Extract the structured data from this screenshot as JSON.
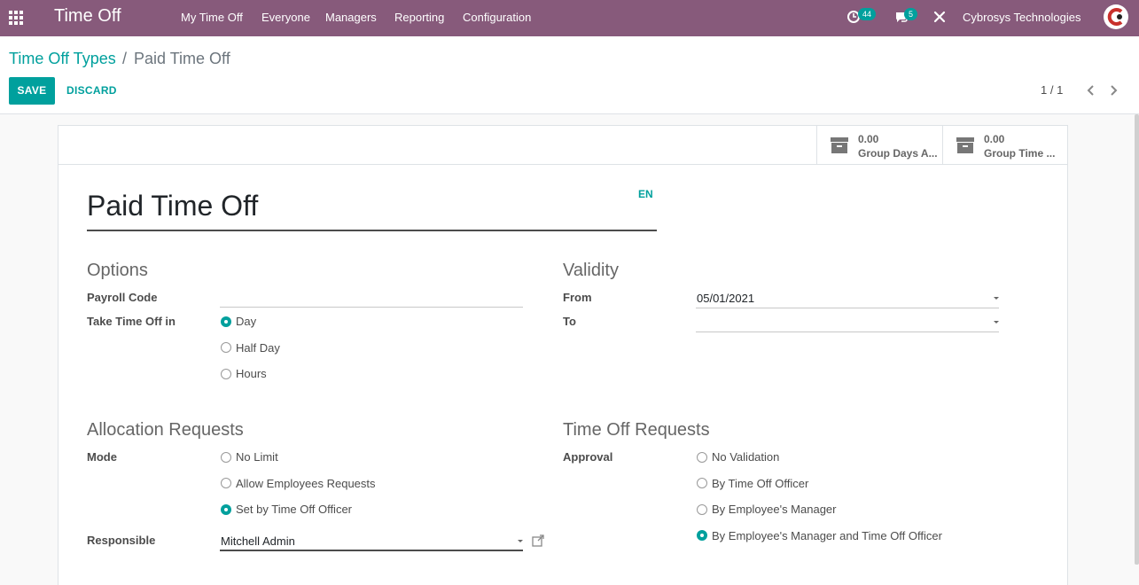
{
  "navbar": {
    "brand": "Time Off",
    "menu": [
      "My Time Off",
      "Everyone",
      "Managers",
      "Reporting",
      "Configuration"
    ],
    "activity_count": "44",
    "messages_count": "5",
    "company": "Cybrosys Technologies"
  },
  "breadcrumb": {
    "parent": "Time Off Types",
    "separator": "/",
    "current": "Paid Time Off"
  },
  "actions": {
    "save": "SAVE",
    "discard": "DISCARD"
  },
  "pager": {
    "value": "1 / 1"
  },
  "stat_buttons": [
    {
      "value": "0.00",
      "label": "Group Days A..."
    },
    {
      "value": "0.00",
      "label": "Group Time ..."
    }
  ],
  "form": {
    "name": "Paid Time Off",
    "lang": "EN",
    "options": {
      "title": "Options",
      "payroll_code_label": "Payroll Code",
      "payroll_code_value": "",
      "take_time_off_label": "Take Time Off in",
      "take_time_off_choices": [
        "Day",
        "Half Day",
        "Hours"
      ],
      "take_time_off_selected": "Day"
    },
    "validity": {
      "title": "Validity",
      "from_label": "From",
      "from_value": "05/01/2021",
      "to_label": "To",
      "to_value": ""
    },
    "allocation": {
      "title": "Allocation Requests",
      "mode_label": "Mode",
      "mode_choices": [
        "No Limit",
        "Allow Employees Requests",
        "Set by Time Off Officer"
      ],
      "mode_selected": "Set by Time Off Officer",
      "responsible_label": "Responsible",
      "responsible_value": "Mitchell Admin"
    },
    "time_off_requests": {
      "title": "Time Off Requests",
      "approval_label": "Approval",
      "approval_choices": [
        "No Validation",
        "By Time Off Officer",
        "By Employee's Manager",
        "By Employee's Manager and Time Off Officer"
      ],
      "approval_selected": "By Employee's Manager and Time Off Officer"
    }
  },
  "colors": {
    "navbar": "#875a7b",
    "accent": "#00a09d"
  }
}
